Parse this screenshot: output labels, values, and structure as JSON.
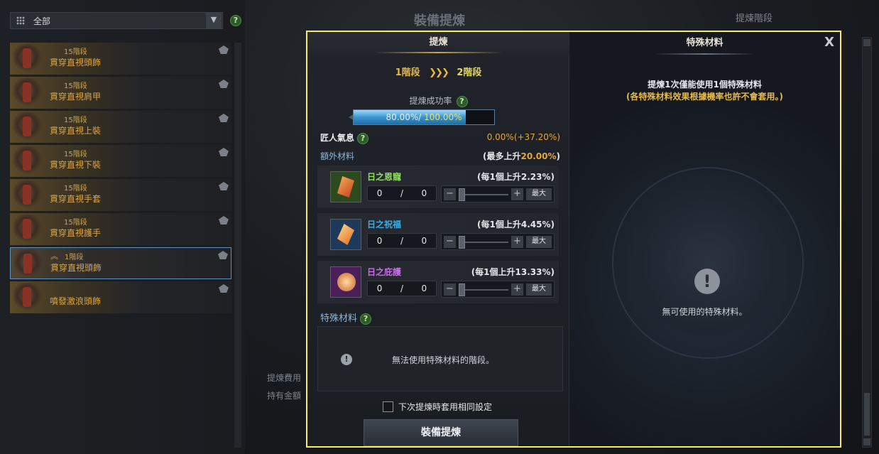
{
  "left": {
    "filter_label": "全部",
    "help": "?",
    "items": [
      {
        "stage": "15階段",
        "name": "貫穿直視頭飾"
      },
      {
        "stage": "15階段",
        "name": "貫穿直視肩甲"
      },
      {
        "stage": "15階段",
        "name": "貫穿直視上裝"
      },
      {
        "stage": "15階段",
        "name": "貫穿直視下裝"
      },
      {
        "stage": "15階段",
        "name": "貫穿直視手套"
      },
      {
        "stage": "15階段",
        "name": "貫穿直視護手"
      },
      {
        "stage": "1階段",
        "name": "貫穿直視頭飾"
      },
      {
        "stage": "",
        "name": "噴發激浪頭飾"
      }
    ]
  },
  "background": {
    "title": "裝備提煉",
    "stage_tab": "提煉階段",
    "fee_label": "提煉費用",
    "gold_label": "持有金額"
  },
  "dialog": {
    "tab_title": "提煉",
    "from_stage": "1階段",
    "arrows": "❯❯❯",
    "to_stage": "2階段",
    "rate_label": "提煉成功率",
    "rate_current": "80.00%",
    "rate_separator": "/ ",
    "rate_max": "100.00%",
    "rate_fraction": 0.8,
    "craftsman_label": "匠人氣息",
    "craftsman_value": "0.00%(+37.20%)",
    "extra_label": "額外材料",
    "extra_max_prefix": "(最多上升",
    "extra_max_pct": "20.00%",
    "extra_max_suffix": ")",
    "materials": [
      {
        "name": "日之恩寵",
        "bonus": "(每1個上升2.23%)",
        "count": "0",
        "sep": "/",
        "total": "0",
        "max_label": "最大",
        "color": "#8ee05c"
      },
      {
        "name": "日之祝福",
        "bonus": "(每1個上升4.45%)",
        "count": "0",
        "sep": "/",
        "total": "0",
        "max_label": "最大",
        "color": "#3aaee8"
      },
      {
        "name": "日之庇護",
        "bonus": "(每1個上升13.33%)",
        "count": "0",
        "sep": "/",
        "total": "0",
        "max_label": "最大",
        "color": "#c86ee8"
      }
    ],
    "special_label": "特殊材料",
    "special_message": "無法使用特殊材料的階段。",
    "same_setting_label": "下次提煉時套用相同設定",
    "refine_button": "裝備提煉",
    "right": {
      "title": "特殊材料",
      "close": "X",
      "info_line1": "提煉1次僅能使用1個特殊材料",
      "info_line2": "(各特殊材料效果根據機率也許不會套用。)",
      "empty_message": "無可使用的特殊材料。"
    }
  },
  "colors": {
    "highlight_border": "#f4ea6c",
    "accent_gold": "#e5a63a"
  }
}
